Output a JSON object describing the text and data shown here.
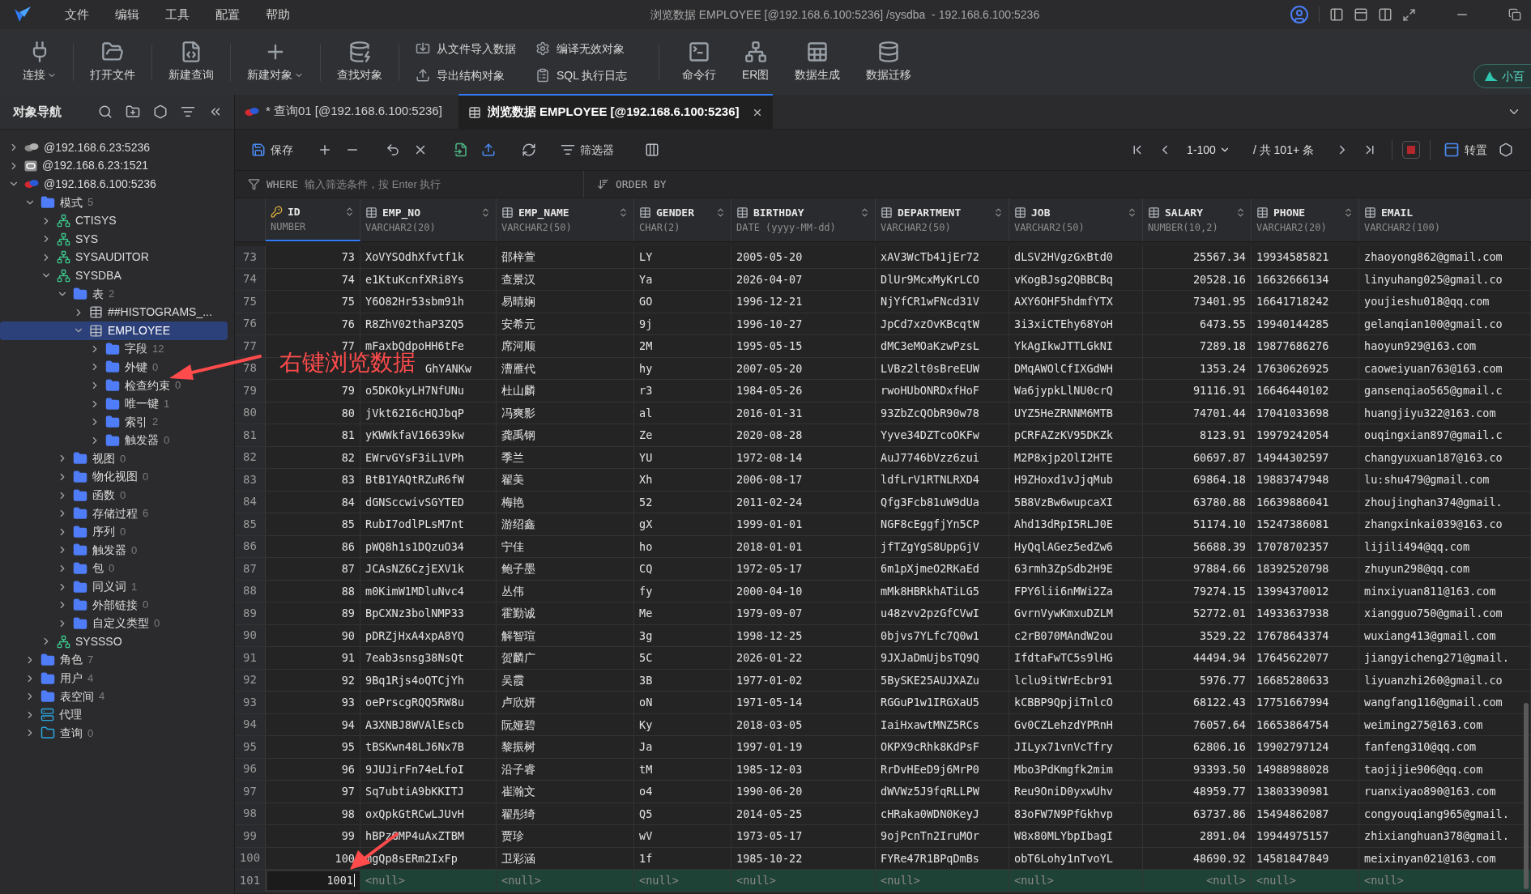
{
  "app": {
    "menu": [
      "文件",
      "编辑",
      "工具",
      "配置",
      "帮助"
    ],
    "title": "浏览数据 EMPLOYEE [@192.168.6.100:5236] /sysdba  - 192.168.6.100:5236"
  },
  "toolbar": [
    {
      "label": "连接",
      "kind": "connect",
      "dropdown": true
    },
    {
      "label": "打开文件",
      "kind": "open",
      "dropdown": false
    },
    {
      "label": "新建查询",
      "kind": "query",
      "dropdown": false
    },
    {
      "label": "新建对象",
      "kind": "plus",
      "dropdown": true
    },
    {
      "label": "查找对象",
      "kind": "find",
      "dropdown": false
    }
  ],
  "toolbar_small": [
    {
      "label": "从文件导入数据",
      "kind": "import"
    },
    {
      "label": "编译无效对象",
      "kind": "compile"
    },
    {
      "label": "导出结构对象",
      "kind": "export"
    },
    {
      "label": "SQL 执行日志",
      "kind": "log"
    }
  ],
  "toolbar_right": [
    {
      "label": "命令行",
      "kind": "terminal"
    },
    {
      "label": "ER图",
      "kind": "er"
    },
    {
      "label": "数据生成",
      "kind": "datagen"
    },
    {
      "label": "数据迁移",
      "kind": "migrate"
    }
  ],
  "assistant_button": "小百",
  "navigator": {
    "title": "对象导航",
    "tree": [
      {
        "label": "@192.168.6.23:5236",
        "kind": "server-grey",
        "expanded": false,
        "selected": false
      },
      {
        "label": "@192.168.6.23:1521",
        "kind": "server-oracle",
        "expanded": false,
        "selected": false
      },
      {
        "label": "@192.168.6.100:5236",
        "kind": "server",
        "expanded": true,
        "selected": false,
        "children": [
          {
            "label": "模式",
            "count": "5",
            "kind": "folder",
            "expanded": true,
            "selected": false,
            "children": [
              {
                "label": "CTISYS",
                "kind": "schema",
                "expanded": false,
                "selected": false
              },
              {
                "label": "SYS",
                "kind": "schema",
                "expanded": false,
                "selected": false
              },
              {
                "label": "SYSAUDITOR",
                "kind": "schema",
                "expanded": false,
                "selected": false
              },
              {
                "label": "SYSDBA",
                "kind": "schema",
                "expanded": true,
                "selected": false,
                "children": [
                  {
                    "label": "表",
                    "count": "2",
                    "kind": "folder",
                    "expanded": true,
                    "selected": false,
                    "children": [
                      {
                        "label": "##HISTOGRAMS_...",
                        "kind": "table",
                        "expanded": false,
                        "selected": false
                      },
                      {
                        "label": "EMPLOYEE",
                        "kind": "table",
                        "expanded": true,
                        "selected": true,
                        "children": [
                          {
                            "label": "字段",
                            "count": "12",
                            "kind": "folder",
                            "expanded": false,
                            "selected": false
                          },
                          {
                            "label": "外键",
                            "count": "0",
                            "kind": "folder",
                            "expanded": false,
                            "selected": false
                          },
                          {
                            "label": "检查约束",
                            "count": "0",
                            "kind": "folder",
                            "expanded": false,
                            "selected": false
                          },
                          {
                            "label": "唯一键",
                            "count": "1",
                            "kind": "folder",
                            "expanded": false,
                            "selected": false
                          },
                          {
                            "label": "索引",
                            "count": "2",
                            "kind": "folder",
                            "expanded": false,
                            "selected": false
                          },
                          {
                            "label": "触发器",
                            "count": "0",
                            "kind": "folder",
                            "expanded": false,
                            "selected": false
                          }
                        ]
                      }
                    ]
                  },
                  {
                    "label": "视图",
                    "count": "0",
                    "kind": "folder",
                    "expanded": false,
                    "selected": false
                  },
                  {
                    "label": "物化视图",
                    "count": "0",
                    "kind": "folder",
                    "expanded": false,
                    "selected": false
                  },
                  {
                    "label": "函数",
                    "count": "0",
                    "kind": "folder",
                    "expanded": false,
                    "selected": false
                  },
                  {
                    "label": "存储过程",
                    "count": "6",
                    "kind": "folder",
                    "expanded": false,
                    "selected": false
                  },
                  {
                    "label": "序列",
                    "count": "0",
                    "kind": "folder",
                    "expanded": false,
                    "selected": false
                  },
                  {
                    "label": "触发器",
                    "count": "0",
                    "kind": "folder",
                    "expanded": false,
                    "selected": false
                  },
                  {
                    "label": "包",
                    "count": "0",
                    "kind": "folder",
                    "expanded": false,
                    "selected": false
                  },
                  {
                    "label": "同义词",
                    "count": "1",
                    "kind": "folder",
                    "expanded": false,
                    "selected": false
                  },
                  {
                    "label": "外部链接",
                    "count": "0",
                    "kind": "folder",
                    "expanded": false,
                    "selected": false
                  },
                  {
                    "label": "自定义类型",
                    "count": "0",
                    "kind": "folder",
                    "expanded": false,
                    "selected": false
                  }
                ]
              },
              {
                "label": "SYSSSO",
                "kind": "schema",
                "expanded": false,
                "selected": false
              }
            ]
          },
          {
            "label": "角色",
            "count": "7",
            "kind": "folder",
            "expanded": false,
            "selected": false
          },
          {
            "label": "用户",
            "count": "4",
            "kind": "folder",
            "expanded": false,
            "selected": false
          },
          {
            "label": "表空间",
            "count": "4",
            "kind": "folder",
            "expanded": false,
            "selected": false
          },
          {
            "label": "代理",
            "kind": "agent",
            "expanded": false,
            "selected": false
          },
          {
            "label": "查询",
            "count": "0",
            "kind": "query-folder",
            "expanded": false,
            "selected": false
          }
        ]
      }
    ]
  },
  "tabs": [
    {
      "label": "* 查询01 [@192.168.6.100:5236]",
      "kind": "query",
      "selected": false,
      "closable": false
    },
    {
      "label": "浏览数据 EMPLOYEE [@192.168.6.100:5236]",
      "kind": "table",
      "selected": true,
      "closable": true
    }
  ],
  "grid_toolbar": {
    "save": "保存",
    "filter": "筛选器",
    "page": "1-100",
    "total": "/ 共 101+ 条",
    "transpose": "转置"
  },
  "filter_bar": {
    "where_label": "WHERE",
    "where_placeholder": "输入筛选条件，按 Enter 执行",
    "order_label": "ORDER BY"
  },
  "table": {
    "columns": [
      {
        "name": "ID",
        "type": "NUMBER",
        "key": true,
        "sortable": true,
        "kind": "number"
      },
      {
        "name": "EMP_NO",
        "type": "VARCHAR2(20)",
        "key": false,
        "sortable": true,
        "kind": "text"
      },
      {
        "name": "EMP_NAME",
        "type": "VARCHAR2(50)",
        "key": false,
        "sortable": true,
        "kind": "text"
      },
      {
        "name": "GENDER",
        "type": "CHAR(2)",
        "key": false,
        "sortable": true,
        "kind": "text"
      },
      {
        "name": "BIRTHDAY",
        "type": "DATE (yyyy-MM-dd)",
        "key": false,
        "sortable": true,
        "kind": "text"
      },
      {
        "name": "DEPARTMENT",
        "type": "VARCHAR2(50)",
        "key": false,
        "sortable": true,
        "kind": "text"
      },
      {
        "name": "JOB",
        "type": "VARCHAR2(50)",
        "key": false,
        "sortable": true,
        "kind": "text"
      },
      {
        "name": "SALARY",
        "type": "NUMBER(10,2)",
        "key": false,
        "sortable": true,
        "kind": "number"
      },
      {
        "name": "PHONE",
        "type": "VARCHAR2(20)",
        "key": false,
        "sortable": true,
        "kind": "text"
      },
      {
        "name": "EMAIL",
        "type": "VARCHAR2(100)",
        "key": false,
        "sortable": false,
        "kind": "text"
      }
    ],
    "rows": [
      {
        "row_number": "73",
        "kind": "data",
        "cells": [
          "73",
          "XoVYSOdhXfvtf1k",
          "邵梓萱",
          "LY",
          "2005-05-20",
          "xAV3WcTb41jEr72",
          "dLSV2HVgzGxBtd0",
          "25567.34",
          "19934585821",
          "zhaoyong862@gmail.com"
        ]
      },
      {
        "row_number": "74",
        "kind": "data",
        "cells": [
          "74",
          "e1KtuKcnfXRi8Ys",
          "查景汉",
          "Ya",
          "2026-04-07",
          "DlUr9McxMyKrLCO",
          "vKogBJsg2QBBCBq",
          "20528.16",
          "16632666134",
          "linyuhang025@gmail.co"
        ]
      },
      {
        "row_number": "75",
        "kind": "data",
        "cells": [
          "75",
          "Y6O82Hr53sbm91h",
          "易晴娴",
          "GO",
          "1996-12-21",
          "NjYfCR1wFNcd31V",
          "AXY6OHF5hdmfYTX",
          "73401.95",
          "16641718242",
          "youjieshu018@qq.com"
        ]
      },
      {
        "row_number": "76",
        "kind": "data",
        "cells": [
          "76",
          "R8ZhV02thaP3ZQ5",
          "安希元",
          "9j",
          "1996-10-27",
          "JpCd7xzOvKBcqtW",
          "3i3xiCTEhy68YoH",
          "6473.55",
          "19940144285",
          "gelanqian100@gmail.co"
        ]
      },
      {
        "row_number": "77",
        "kind": "data",
        "cells": [
          "77",
          "mFaxbQdpoHH6tFe",
          "席河顺",
          "2M",
          "1995-05-15",
          "dMC3eMOaKzwPzsL",
          "YkAgIkwJTTLGkNI",
          "7289.18",
          "19877686276",
          "haoyun929@163.com"
        ]
      },
      {
        "row_number": "78",
        "kind": "covered",
        "cells": [
          null,
          "GhYANKw",
          "漕雁代",
          "hy",
          "2007-05-20",
          "LVBz2lt0sBreEUW",
          "DMqAWOlCfIXGdWH",
          "1353.24",
          "17630626925",
          "caoweiyuan763@163.com"
        ]
      },
      {
        "row_number": "79",
        "kind": "data",
        "cells": [
          "79",
          "o5DKOkyLH7NfUNu",
          "杜山麟",
          "r3",
          "1984-05-26",
          "rwoHUbONRDxfHoF",
          "Wa6jypkLlNU0crQ",
          "91116.91",
          "16646440102",
          "gansenqiao565@gmail.c"
        ]
      },
      {
        "row_number": "80",
        "kind": "data",
        "cells": [
          "80",
          "jVkt62I6cHQJbqP",
          "冯爽影",
          "al",
          "2016-01-31",
          "93ZbZcQObR90w78",
          "UYZ5HeZRNNM6MTB",
          "74701.44",
          "17041033698",
          "huangjiyu322@163.com"
        ]
      },
      {
        "row_number": "81",
        "kind": "data",
        "cells": [
          "81",
          "yKWWkfaV16639kw",
          "龚禹钢",
          "Ze",
          "2020-08-28",
          "Yyve34DZTcoOKFw",
          "pCRFAZzKV95DKZk",
          "8123.91",
          "19979242054",
          "ouqingxian897@gmail.c"
        ]
      },
      {
        "row_number": "82",
        "kind": "data",
        "cells": [
          "82",
          "EWrvGYsF3iL1VPh",
          "季兰",
          "YU",
          "1972-08-14",
          "AuJ7746bVzz6zui",
          "M2P8xjp2OlI2HTE",
          "60697.87",
          "14944302597",
          "changyuxuan187@163.co"
        ]
      },
      {
        "row_number": "83",
        "kind": "data",
        "cells": [
          "83",
          "BtB1YAQtRZuR6fW",
          "翟美",
          "Xh",
          "2006-08-17",
          "ldfLrV1RTNLRXD4",
          "H9ZHoxd1vJjqMub",
          "69864.18",
          "19883747948",
          "lu:shu479@gmail.com"
        ]
      },
      {
        "row_number": "84",
        "kind": "data",
        "cells": [
          "84",
          "dGNSccwivSGYTED",
          "梅艳",
          "52",
          "2011-02-24",
          "Qfg3Fcb81uW9dUa",
          "5B8VzBw6wupcaXI",
          "63780.88",
          "16639886041",
          "zhoujinghan374@gmail."
        ]
      },
      {
        "row_number": "85",
        "kind": "data",
        "cells": [
          "85",
          "RubI7odlPLsM7nt",
          "游绍鑫",
          "gX",
          "1999-01-01",
          "NGF8cEggfjYn5CP",
          "Ahd13dRpI5RLJ0E",
          "51174.10",
          "15247386081",
          "zhangxinkai039@163.co"
        ]
      },
      {
        "row_number": "86",
        "kind": "data",
        "cells": [
          "86",
          "pWQ8h1s1DQzuO34",
          "宁佳",
          "ho",
          "2018-01-01",
          "jfTZgYgS8UppGjV",
          "HyQqlAGez5edZw6",
          "56688.39",
          "17078702357",
          "lijili494@qq.com"
        ]
      },
      {
        "row_number": "87",
        "kind": "data",
        "cells": [
          "87",
          "JCAsNZ6CzjEXV1k",
          "鲍子墨",
          "CQ",
          "1972-05-17",
          "6m1pXjmeO2RKaEd",
          "63rmh3ZpSdb2H9E",
          "97884.66",
          "18392520798",
          "zhuyun298@qq.com"
        ]
      },
      {
        "row_number": "88",
        "kind": "data",
        "cells": [
          "88",
          "m0KimW1MDluNvc4",
          "丛伟",
          "fy",
          "2000-04-10",
          "mMk8HBRkhATiLG5",
          "FPY6lii6nMWi2Za",
          "79274.15",
          "13994370012",
          "minxiyuan811@163.com"
        ]
      },
      {
        "row_number": "89",
        "kind": "data",
        "cells": [
          "89",
          "BpCXNz3bolNMP33",
          "霍勤诚",
          "Me",
          "1979-09-07",
          "u48zvv2pzGfCVwI",
          "GvrnVywKmxuDZLM",
          "52772.01",
          "14933637938",
          "xiangguo750@gmail.com"
        ]
      },
      {
        "row_number": "90",
        "kind": "data",
        "cells": [
          "90",
          "pDRZjHxA4xpA8YQ",
          "解智瑄",
          "3g",
          "1998-12-25",
          "0bjvs7YLfc7Q0w1",
          "c2rB070MAndW2ou",
          "3529.22",
          "17678643374",
          "wuxiang413@gmail.com"
        ]
      },
      {
        "row_number": "91",
        "kind": "data",
        "cells": [
          "91",
          "7eab3snsg38NsQt",
          "贺麟广",
          "5C",
          "2026-01-22",
          "9JXJaDmUjbsTQ9Q",
          "IfdtaFwTC5s9lHG",
          "44494.94",
          "17645622077",
          "jiangyicheng271@gmail."
        ]
      },
      {
        "row_number": "92",
        "kind": "data",
        "cells": [
          "92",
          "9Bq1Rjs4oQTCjYh",
          "吴霞",
          "3B",
          "1977-01-02",
          "5BySKE25AUJXAZu",
          "lclu9itWrEcbr91",
          "5976.77",
          "16685280633",
          "liyuanzhi260@gmail.co"
        ]
      },
      {
        "row_number": "93",
        "kind": "data",
        "cells": [
          "93",
          "oePrscgRQQ5RW8u",
          "卢欣妍",
          "oN",
          "1971-05-14",
          "RGGuP1w1IRGXaU5",
          "kCBBP9QpjiTnlcO",
          "68122.43",
          "17751667994",
          "wangfang116@gmail.com"
        ]
      },
      {
        "row_number": "94",
        "kind": "data",
        "cells": [
          "94",
          "A3XNBJ8WVAlEscb",
          "阮娅碧",
          "Ky",
          "2018-03-05",
          "IaiHxawtMNZ5RCs",
          "Gv0CZLehzdYPRnH",
          "76057.64",
          "16653864754",
          "weiming275@163.com"
        ]
      },
      {
        "row_number": "95",
        "kind": "data",
        "cells": [
          "95",
          "tBSKwn48LJ6Nx7B",
          "黎振树",
          "Ja",
          "1997-01-19",
          "OKPX9cRhk8KdPsF",
          "JILyx71vnVcTfry",
          "62806.16",
          "19902797124",
          "fanfeng310@qq.com"
        ]
      },
      {
        "row_number": "96",
        "kind": "data",
        "cells": [
          "96",
          "9JUJirFn74eLfoI",
          "沿子睿",
          "tM",
          "1985-12-03",
          "RrDvHEeD9j6MrP0",
          "Mbo3PdKmgfk2mim",
          "93393.50",
          "14988988028",
          "taojijie906@qq.com"
        ]
      },
      {
        "row_number": "97",
        "kind": "data",
        "cells": [
          "97",
          "Sq7ubtiA9bKKITJ",
          "崔瀚文",
          "o4",
          "1990-06-20",
          "dWVWz5J9fqRLLPW",
          "Reu9OniD0yxwUhv",
          "48959.77",
          "13803390981",
          "ruanxiyao890@163.com"
        ]
      },
      {
        "row_number": "98",
        "kind": "data",
        "cells": [
          "98",
          "oxQpkGtRCwLJUvH",
          "翟彤绮",
          "Q5",
          "2014-05-25",
          "cHRaka0WDN0KeyJ",
          "83oFW7N9PfGkhvp",
          "63737.86",
          "15494862087",
          "congyouqiang965@gmail."
        ]
      },
      {
        "row_number": "99",
        "kind": "data",
        "cells": [
          "99",
          "hBPzGMP4uAxZTBM",
          "贾珍",
          "wV",
          "1973-05-17",
          "9ojPcnTn2IruMOr",
          "W8x80MLYbpIbagI",
          "2891.04",
          "19944975157",
          "zhixianghuan378@gmail."
        ]
      },
      {
        "row_number": "100",
        "kind": "data",
        "cells": [
          "100",
          "mgQp8sERm2IxFp",
          "卫彩涵",
          "1f",
          "1985-10-22",
          "FYRe47R1BPqDmBs",
          "obT6Lohy1nTvoYL",
          "48690.92",
          "14581847849",
          "meixinyan021@163.com"
        ]
      },
      {
        "row_number": "101",
        "kind": "new",
        "cells": [
          "1001",
          "<null>",
          "<null>",
          "<null>",
          "<null>",
          "<null>",
          "<null>",
          "<null>",
          "<null>",
          "<null>"
        ]
      }
    ]
  },
  "annotation": {
    "text": "右键浏览数据"
  }
}
